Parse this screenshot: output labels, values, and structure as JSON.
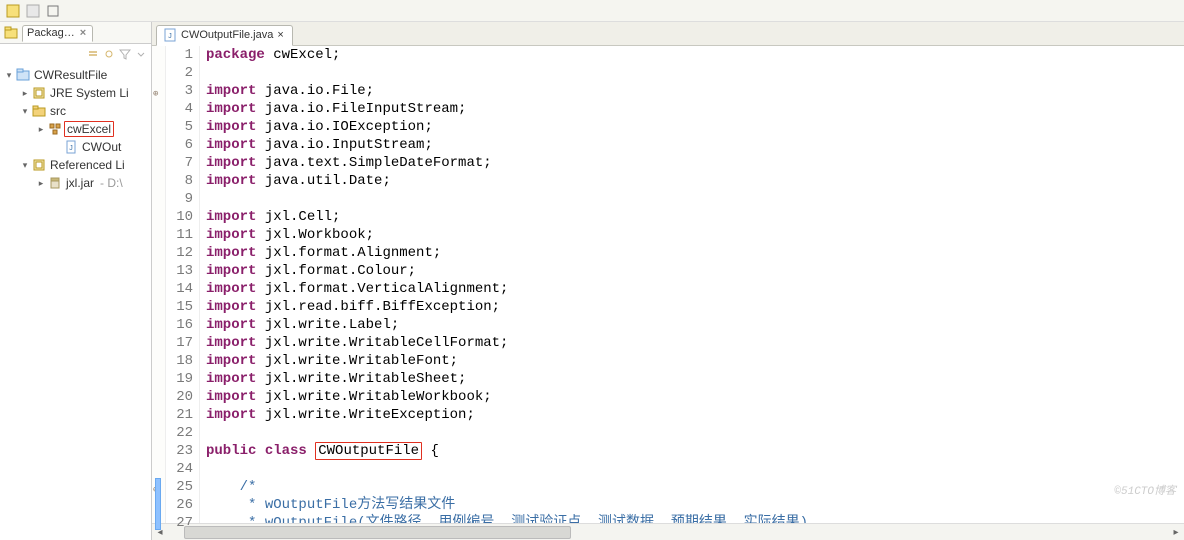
{
  "toolbar": {
    "icons": [
      "sq1",
      "sq2",
      "sq3",
      "sep",
      "sq4"
    ]
  },
  "packageExplorer": {
    "tabTitle": "Packag…",
    "miniTools": [
      "collapse",
      "link",
      "filter",
      "menu"
    ],
    "tree": [
      {
        "level": 0,
        "expander": "▾",
        "icon": "project",
        "label": "CWResultFile"
      },
      {
        "level": 1,
        "expander": "▸",
        "icon": "lib",
        "label": "JRE System Li"
      },
      {
        "level": 1,
        "expander": "▾",
        "icon": "srcfolder",
        "label": "src"
      },
      {
        "level": 2,
        "expander": "▸",
        "icon": "package",
        "label": "cwExcel",
        "highlight": true
      },
      {
        "level": 3,
        "expander": "",
        "icon": "javafile",
        "label": "CWOut"
      },
      {
        "level": 1,
        "expander": "▾",
        "icon": "lib",
        "label": "Referenced Li"
      },
      {
        "level": 2,
        "expander": "▸",
        "icon": "jar",
        "label": "jxl.jar",
        "suffix": " - D:\\"
      }
    ]
  },
  "editor": {
    "tabTitle": "CWOutputFile.java",
    "annotations": {
      "foldAt": 3,
      "commentBlock": {
        "startLine": 25,
        "endLine": 27
      }
    },
    "lines": [
      {
        "n": 1,
        "tokens": [
          {
            "t": "package",
            "c": "kw"
          },
          {
            "t": " cwExcel;"
          }
        ]
      },
      {
        "n": 2,
        "tokens": []
      },
      {
        "n": 3,
        "tokens": [
          {
            "t": "import",
            "c": "kw"
          },
          {
            "t": " java.io.File;"
          }
        ],
        "fold": true
      },
      {
        "n": 4,
        "tokens": [
          {
            "t": "import",
            "c": "kw"
          },
          {
            "t": " java.io.FileInputStream;"
          }
        ]
      },
      {
        "n": 5,
        "tokens": [
          {
            "t": "import",
            "c": "kw"
          },
          {
            "t": " java.io.IOException;"
          }
        ]
      },
      {
        "n": 6,
        "tokens": [
          {
            "t": "import",
            "c": "kw"
          },
          {
            "t": " java.io.InputStream;"
          }
        ]
      },
      {
        "n": 7,
        "tokens": [
          {
            "t": "import",
            "c": "kw"
          },
          {
            "t": " java.text.SimpleDateFormat;"
          }
        ]
      },
      {
        "n": 8,
        "tokens": [
          {
            "t": "import",
            "c": "kw"
          },
          {
            "t": " java.util.Date;"
          }
        ]
      },
      {
        "n": 9,
        "tokens": []
      },
      {
        "n": 10,
        "tokens": [
          {
            "t": "import",
            "c": "kw"
          },
          {
            "t": " jxl.Cell;"
          }
        ]
      },
      {
        "n": 11,
        "tokens": [
          {
            "t": "import",
            "c": "kw"
          },
          {
            "t": " jxl.Workbook;"
          }
        ]
      },
      {
        "n": 12,
        "tokens": [
          {
            "t": "import",
            "c": "kw"
          },
          {
            "t": " jxl.format.Alignment;"
          }
        ]
      },
      {
        "n": 13,
        "tokens": [
          {
            "t": "import",
            "c": "kw"
          },
          {
            "t": " jxl.format.Colour;"
          }
        ]
      },
      {
        "n": 14,
        "tokens": [
          {
            "t": "import",
            "c": "kw"
          },
          {
            "t": " jxl.format.VerticalAlignment;"
          }
        ]
      },
      {
        "n": 15,
        "tokens": [
          {
            "t": "import",
            "c": "kw"
          },
          {
            "t": " jxl.read.biff.BiffException;"
          }
        ]
      },
      {
        "n": 16,
        "tokens": [
          {
            "t": "import",
            "c": "kw"
          },
          {
            "t": " jxl.write.Label;"
          }
        ]
      },
      {
        "n": 17,
        "tokens": [
          {
            "t": "import",
            "c": "kw"
          },
          {
            "t": " jxl.write.WritableCellFormat;"
          }
        ]
      },
      {
        "n": 18,
        "tokens": [
          {
            "t": "import",
            "c": "kw"
          },
          {
            "t": " jxl.write.WritableFont;"
          }
        ]
      },
      {
        "n": 19,
        "tokens": [
          {
            "t": "import",
            "c": "kw"
          },
          {
            "t": " jxl.write.WritableSheet;"
          }
        ]
      },
      {
        "n": 20,
        "tokens": [
          {
            "t": "import",
            "c": "kw"
          },
          {
            "t": " jxl.write.WritableWorkbook;"
          }
        ]
      },
      {
        "n": 21,
        "tokens": [
          {
            "t": "import",
            "c": "kw"
          },
          {
            "t": " jxl.write.WriteException;"
          }
        ]
      },
      {
        "n": 22,
        "tokens": []
      },
      {
        "n": 23,
        "tokens": [
          {
            "t": "public",
            "c": "kw"
          },
          {
            "t": " "
          },
          {
            "t": "class",
            "c": "kw"
          },
          {
            "t": " "
          },
          {
            "t": "CWOutputFile",
            "box": true
          },
          {
            "t": " {"
          }
        ]
      },
      {
        "n": 24,
        "tokens": []
      },
      {
        "n": 25,
        "tokens": [
          {
            "t": "    "
          },
          {
            "t": "/*",
            "c": "cmt"
          }
        ],
        "fold": true
      },
      {
        "n": 26,
        "tokens": [
          {
            "t": "     "
          },
          {
            "t": "* wOutputFile方法写结果文件",
            "c": "cmt"
          }
        ]
      },
      {
        "n": 27,
        "tokens": [
          {
            "t": "     "
          },
          {
            "t": "* wOutputFile(文件路径  用例编号  测试验证点  测试数据  预期结果  实际结果)",
            "c": "cmt"
          }
        ]
      }
    ]
  },
  "watermark": "©51CTO博客"
}
